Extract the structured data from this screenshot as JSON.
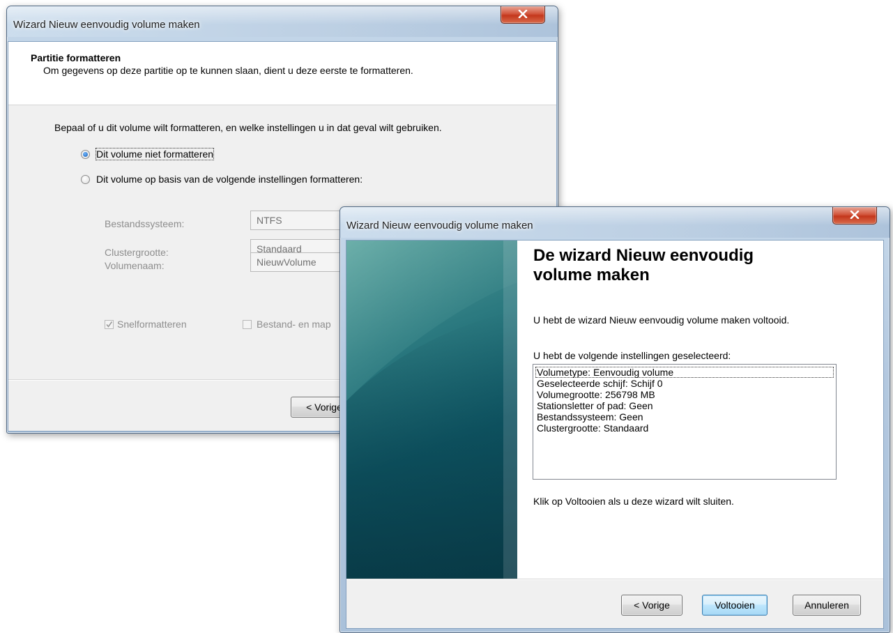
{
  "back_window": {
    "title": "Wizard Nieuw eenvoudig volume maken",
    "header": {
      "title": "Partitie formatteren",
      "subtitle": "Om gegevens op deze partitie op te kunnen slaan, dient u deze eerste te formatteren."
    },
    "prompt": "Bepaal of u dit volume wilt formatteren, en welke instellingen u in dat geval wilt gebruiken.",
    "options": [
      {
        "label": "Dit volume niet formatteren",
        "selected": true
      },
      {
        "label": "Dit volume op basis van de volgende instellingen formatteren:",
        "selected": false
      }
    ],
    "settings": [
      {
        "label": "Bestandssysteem:",
        "value": "NTFS"
      },
      {
        "label": "Clustergrootte:",
        "value": "Standaard"
      },
      {
        "label": "Volumenaam:",
        "value": "NieuwVolume"
      }
    ],
    "quick_format": {
      "label": "Snelformatteren",
      "checked": true
    },
    "compression": {
      "label": "Bestand- en map",
      "checked": false
    },
    "back_button": "< Vorige"
  },
  "front_window": {
    "title": "Wizard Nieuw eenvoudig volume maken",
    "heading_line1": "De wizard Nieuw eenvoudig",
    "heading_line2": "volume maken",
    "completed_text": "U hebt de wizard Nieuw eenvoudig volume maken voltooid.",
    "settings_label": "U hebt de volgende instellingen geselecteerd:",
    "settings_list": [
      "Volumetype: Eenvoudig volume",
      "Geselecteerde schijf: Schijf 0",
      "Volumegrootte: 256798 MB",
      "Stationsletter of pad: Geen",
      "Bestandssysteem: Geen",
      "Clustergrootte: Standaard"
    ],
    "close_text": "Klik op Voltooien als u deze wizard wilt sluiten.",
    "buttons": {
      "back": "< Vorige",
      "finish": "Voltooien",
      "cancel": "Annuleren"
    }
  },
  "colors": {
    "glass": "#b9cde2",
    "dialog_bg": "#f0f0f0",
    "banner_dark": "#0e4a57",
    "banner_light": "#4f9f9f",
    "close_red": "#c3371c"
  }
}
